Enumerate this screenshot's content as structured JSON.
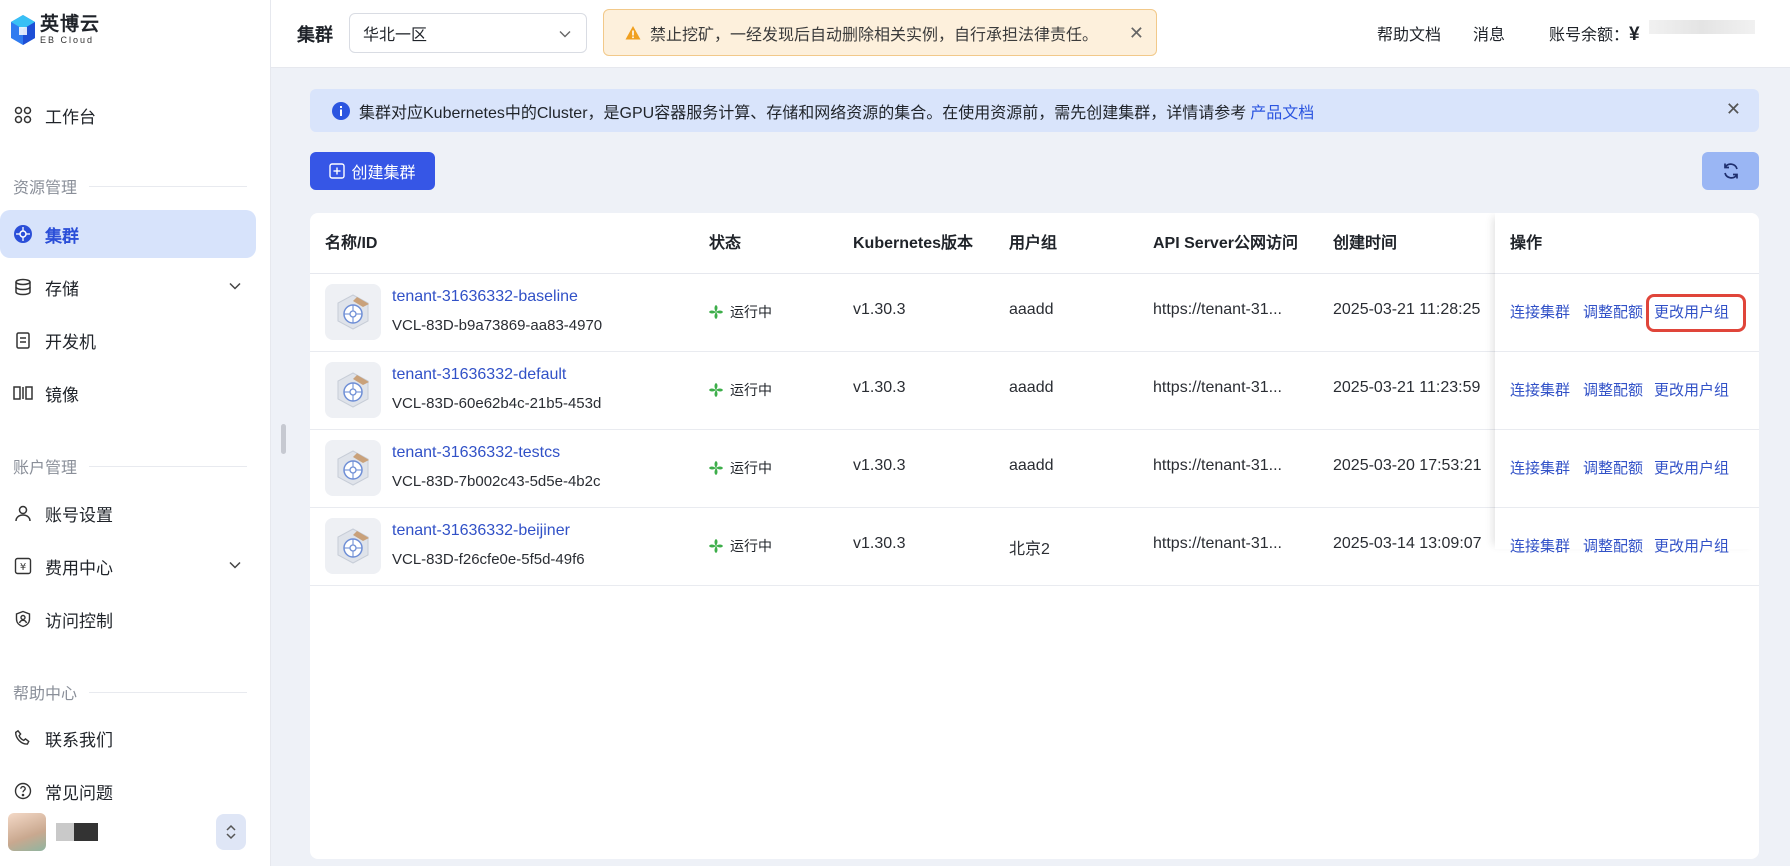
{
  "brand": {
    "name_cn": "英博云",
    "name_en": "EB Cloud"
  },
  "sidebar": {
    "workbench": "工作台",
    "sections": {
      "resource": "资源管理",
      "account": "账户管理",
      "help": "帮助中心"
    },
    "items": {
      "cluster": "集群",
      "storage": "存储",
      "devbox": "开发机",
      "image": "镜像",
      "account_settings": "账号设置",
      "billing": "费用中心",
      "access_control": "访问控制",
      "contact": "联系我们",
      "faq": "常见问题"
    }
  },
  "header": {
    "title": "集群",
    "region": "华北一区",
    "warning": "禁止挖矿，一经发现后自动删除相关实例，自行承担法律责任。",
    "help_docs": "帮助文档",
    "messages": "消息",
    "balance_label": "账号余额：",
    "currency": "¥"
  },
  "info": {
    "text": "集群对应Kubernetes中的Cluster，是GPU容器服务计算、存储和网络资源的集合。在使用资源前，需先创建集群，详情请参考",
    "link": "产品文档"
  },
  "toolbar": {
    "create_label": "创建集群"
  },
  "table": {
    "columns": {
      "name": "名称/ID",
      "status": "状态",
      "k8s": "Kubernetes版本",
      "group": "用户组",
      "api": "API Server公网访问",
      "created": "创建时间",
      "ops": "操作"
    },
    "rows": [
      {
        "name": "tenant-31636332-baseline",
        "id": "VCL-83D-b9a73869-aa83-4970",
        "status": "运行中",
        "k8s": "v1.30.3",
        "group": "aaadd",
        "api": "https://tenant-31...",
        "created": "2025-03-21 11:28:25"
      },
      {
        "name": "tenant-31636332-default",
        "id": "VCL-83D-60e62b4c-21b5-453d",
        "status": "运行中",
        "k8s": "v1.30.3",
        "group": "aaadd",
        "api": "https://tenant-31...",
        "created": "2025-03-21 11:23:59"
      },
      {
        "name": "tenant-31636332-testcs",
        "id": "VCL-83D-7b002c43-5d5e-4b2c",
        "status": "运行中",
        "k8s": "v1.30.3",
        "group": "aaadd",
        "api": "https://tenant-31...",
        "created": "2025-03-20 17:53:21"
      },
      {
        "name": "tenant-31636332-beijiner",
        "id": "VCL-83D-f26cfe0e-5f5d-49f6",
        "status": "运行中",
        "k8s": "v1.30.3",
        "group": "北京2",
        "api": "https://tenant-31...",
        "created": "2025-03-14 13:09:07"
      }
    ],
    "ops": {
      "connect": "连接集群",
      "quota": "调整配额",
      "change_group": "更改用户组"
    }
  },
  "colors": {
    "accent": "#3656e6",
    "link": "#3151c7",
    "running": "#3dae4a",
    "highlight": "#e0453a"
  }
}
